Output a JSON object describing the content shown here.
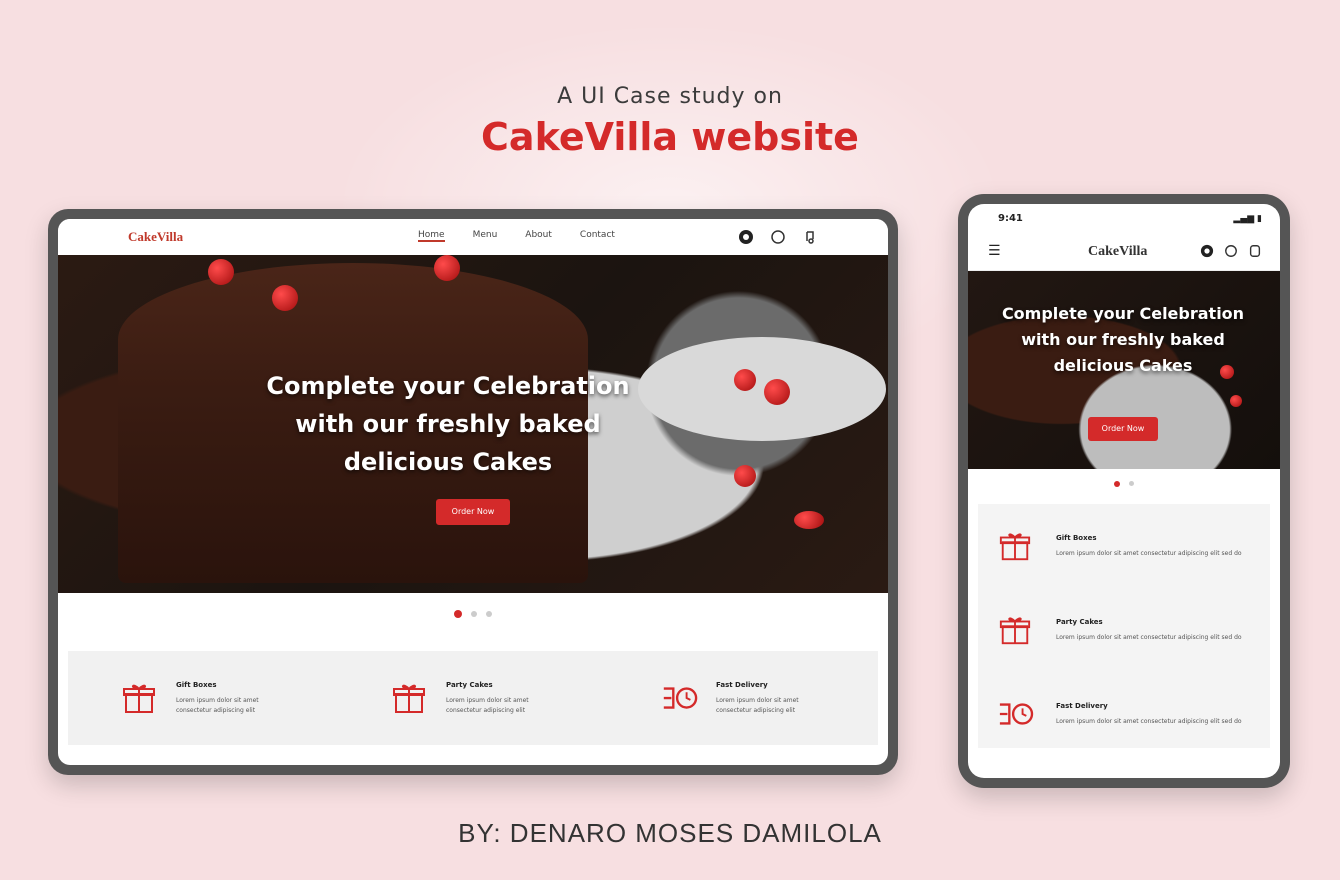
{
  "heading": {
    "subtitle": "A UI Case study on",
    "title": "CakeVilla website"
  },
  "byline": "BY: DENARO MOSES DAMILOLA",
  "colors": {
    "accent": "#d42a2a",
    "background": "#f7dfe1",
    "frame": "#555555"
  },
  "desktop": {
    "logo": "CakeVilla",
    "nav_links": [
      "Home",
      "Menu",
      "About",
      "Contact"
    ],
    "icons": [
      "cart-icon",
      "search-icon",
      "user-icon"
    ],
    "hero": {
      "headline": "Complete your Celebration with our freshly baked delicious Cakes",
      "cta": "Order Now"
    },
    "features": [
      {
        "icon": "gift-icon",
        "title": "Gift Boxes",
        "desc": "Lorem ipsum dolor sit amet consectetur adipiscing elit"
      },
      {
        "icon": "gift-icon",
        "title": "Party Cakes",
        "desc": "Lorem ipsum dolor sit amet consectetur adipiscing elit"
      },
      {
        "icon": "delivery-icon",
        "title": "Fast Delivery",
        "desc": "Lorem ipsum dolor sit amet consectetur adipiscing elit"
      }
    ]
  },
  "phone": {
    "time": "9:41",
    "status": "▂▄▆ ▮",
    "logo": "CakeVilla",
    "hero": {
      "headline": "Complete your Celebration with our freshly baked delicious Cakes",
      "cta": "Order Now"
    },
    "features": [
      {
        "icon": "gift-icon",
        "title": "Gift Boxes",
        "desc": "Lorem ipsum dolor sit amet consectetur adipiscing elit sed do"
      },
      {
        "icon": "gift-icon",
        "title": "Party Cakes",
        "desc": "Lorem ipsum dolor sit amet consectetur adipiscing elit sed do"
      },
      {
        "icon": "delivery-icon",
        "title": "Fast Delivery",
        "desc": "Lorem ipsum dolor sit amet consectetur adipiscing elit sed do"
      }
    ]
  }
}
